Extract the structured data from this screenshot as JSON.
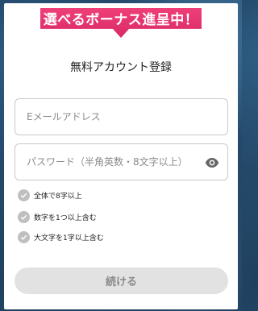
{
  "banner": {
    "text": "選べるボーナス進呈中！"
  },
  "form": {
    "title": "無料アカウント登録",
    "email": {
      "placeholder": "Eメールアドレス",
      "value": ""
    },
    "password": {
      "placeholder": "パスワード（半角英数・8文字以上）",
      "value": ""
    },
    "requirements": [
      {
        "label": "全体で8字以上"
      },
      {
        "label": "数字を1つ以上含む"
      },
      {
        "label": "大文字を1字以上含む"
      }
    ],
    "submit_label": "続ける"
  },
  "icons": {
    "toggle_visibility": "eye-icon",
    "requirement": "check-circle-icon"
  },
  "colors": {
    "banner": "#e3346d",
    "check_inactive": "#bfbfbf",
    "button_disabled": "#e2e2e2"
  }
}
